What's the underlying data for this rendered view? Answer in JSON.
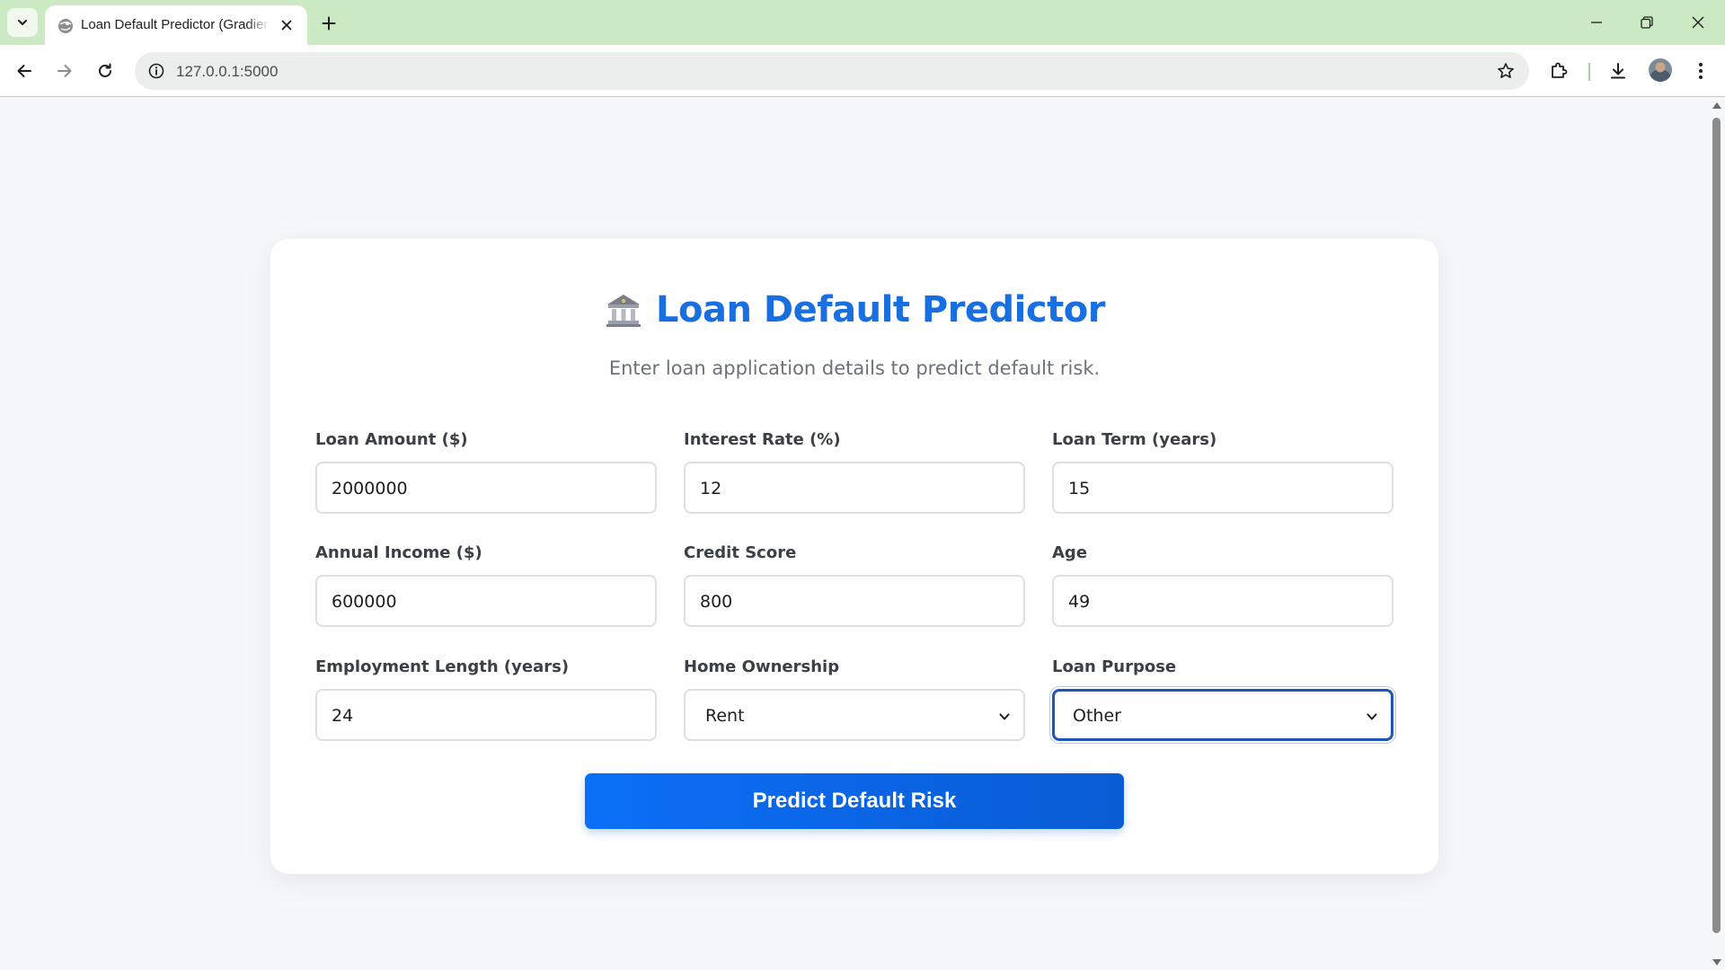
{
  "browser": {
    "tab_title": "Loan Default Predictor (Gradient Boosting)",
    "url": "127.0.0.1:5000",
    "icons": {
      "tab_search": "chevron-down-icon",
      "favicon": "globe-icon",
      "tab_close": "close-icon",
      "new_tab": "plus-icon",
      "minimize": "minimize-icon",
      "restore": "restore-icon",
      "close": "close-icon",
      "back": "back-arrow-icon",
      "forward": "forward-arrow-icon",
      "reload": "reload-icon",
      "site_info": "info-icon",
      "bookmark": "star-icon",
      "extensions": "puzzle-icon",
      "downloads": "download-icon",
      "profile": "avatar",
      "menu": "kebab-menu-icon"
    }
  },
  "page": {
    "title": "Loan Default Predictor",
    "title_icon": "bank-icon",
    "subtitle": "Enter loan application details to predict default risk.",
    "accent_color": "#1a6fe0"
  },
  "form": {
    "loan_amount": {
      "label": "Loan Amount ($)",
      "value": "2000000"
    },
    "interest_rate": {
      "label": "Interest Rate (%)",
      "value": "12"
    },
    "loan_term": {
      "label": "Loan Term (years)",
      "value": "15"
    },
    "annual_income": {
      "label": "Annual Income ($)",
      "value": "600000"
    },
    "credit_score": {
      "label": "Credit Score",
      "value": "800"
    },
    "age": {
      "label": "Age",
      "value": "49"
    },
    "employment_length": {
      "label": "Employment Length (years)",
      "value": "24"
    },
    "home_ownership": {
      "label": "Home Ownership",
      "value": "Rent"
    },
    "loan_purpose": {
      "label": "Loan Purpose",
      "value": "Other"
    },
    "submit_label": "Predict Default Risk"
  }
}
